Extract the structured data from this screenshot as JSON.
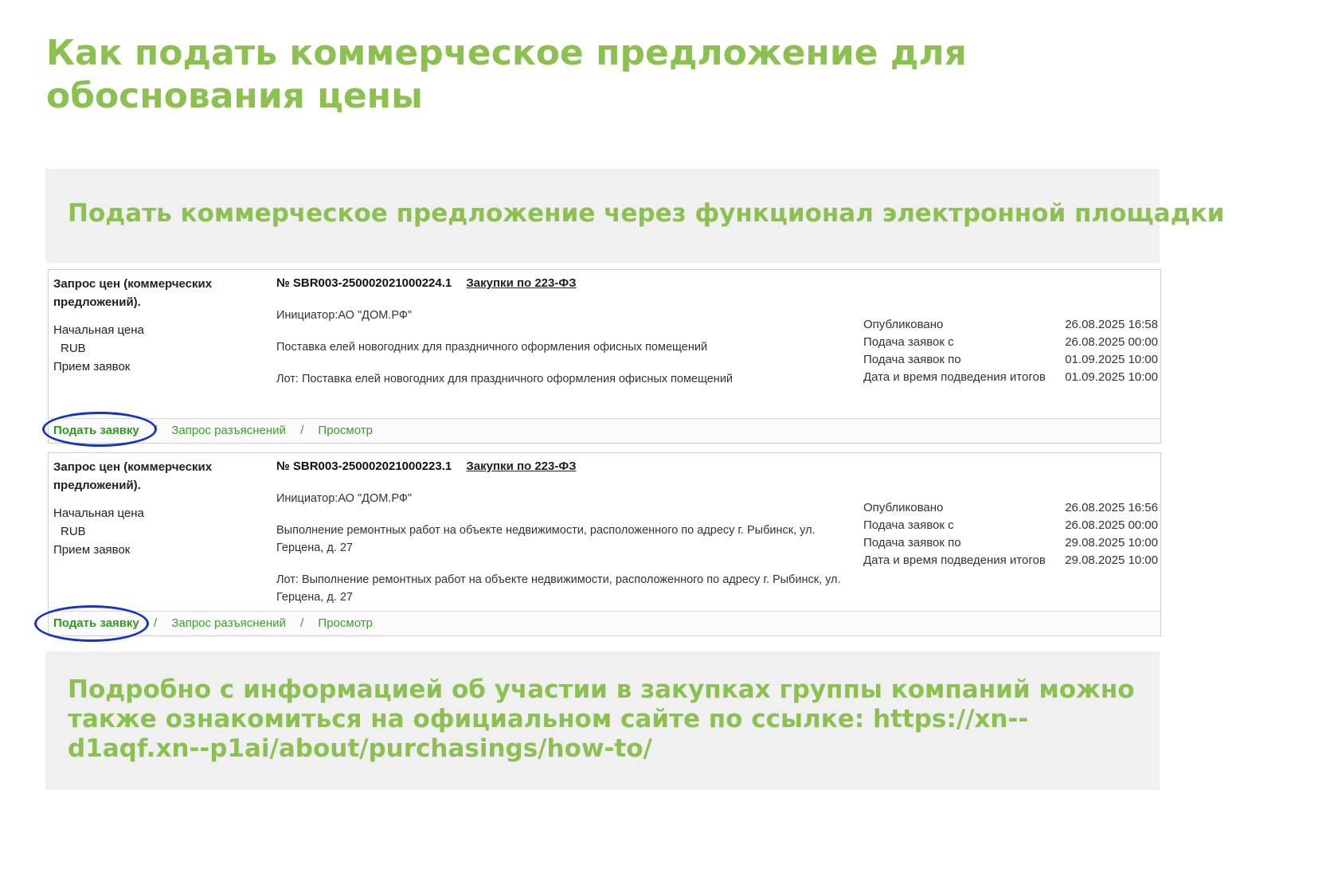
{
  "page": {
    "title": "Как подать коммерческое предложение для обоснования цены"
  },
  "section_top": {
    "heading": "Подать коммерческое предложение через функционал электронной площадки"
  },
  "cards": [
    {
      "type": "Запрос цен (коммерческих предложений).",
      "start_price_label": "Начальная цена",
      "currency": "RUB",
      "reception_label": "Прием заявок",
      "number": "№ SBR003-250002021000224.1",
      "law_link": "Закупки по 223-ФЗ",
      "initiator": "Инициатор:АО \"ДОМ.РФ\"",
      "subject": "Поставка елей новогодних для праздничного оформления офисных помещений",
      "lot": "Лот: Поставка елей новогодних для праздничного оформления офисных помещений",
      "dates": [
        {
          "label": "Опубликовано",
          "value": "26.08.2025 16:58"
        },
        {
          "label": "Подача заявок с",
          "value": "26.08.2025 00:00"
        },
        {
          "label": "Подача заявок по",
          "value": "01.09.2025 10:00"
        },
        {
          "label": "Дата и время подведения итогов",
          "value": "01.09.2025 10:00"
        }
      ],
      "actions": {
        "apply": "Подать заявку",
        "clarify": "Запрос разъяснений",
        "view": "Просмотр",
        "separator": "/"
      }
    },
    {
      "type": "Запрос цен (коммерческих предложений).",
      "start_price_label": "Начальная цена",
      "currency": "RUB",
      "reception_label": "Прием заявок",
      "number": "№ SBR003-250002021000223.1",
      "law_link": "Закупки по 223-ФЗ",
      "initiator": "Инициатор:АО \"ДОМ.РФ\"",
      "subject": "Выполнение ремонтных работ на объекте недвижимости, расположенного по адресу г. Рыбинск, ул. Герцена, д. 27",
      "lot": "Лот: Выполнение ремонтных работ на объекте недвижимости, расположенного по адресу г. Рыбинск, ул. Герцена, д. 27",
      "dates": [
        {
          "label": "Опубликовано",
          "value": "26.08.2025 16:56"
        },
        {
          "label": "Подача заявок с",
          "value": "26.08.2025 00:00"
        },
        {
          "label": "Подача заявок по",
          "value": "29.08.2025 10:00"
        },
        {
          "label": "Дата и время подведения итогов",
          "value": "29.08.2025 10:00"
        }
      ],
      "actions": {
        "apply": "Подать заявку",
        "clarify": "Запрос разъяснений",
        "view": "Просмотр",
        "separator": "/"
      }
    }
  ],
  "section_bottom": {
    "heading": "Подробно с информацией об участии в закупках группы компаний можно также ознакомиться на официальном сайте по ссылке: https://xn--d1aqf.xn--p1ai/about/purchasings/how-to/"
  },
  "colors": {
    "accent_green": "#8cc152",
    "link_green": "#3aa02a",
    "highlight_circle": "#1633c6",
    "panel_bg": "#f0f0f0"
  }
}
